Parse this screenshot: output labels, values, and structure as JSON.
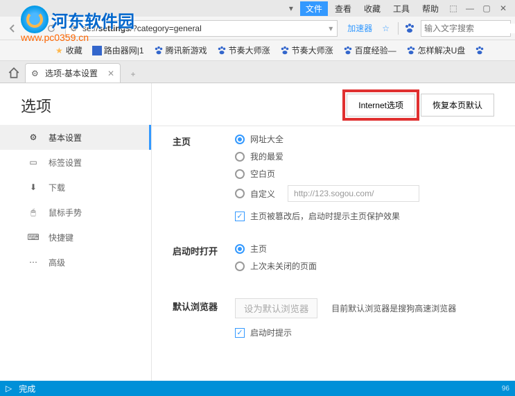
{
  "watermark": {
    "line1": "河东软件园",
    "line2": "www.pc0359.cn"
  },
  "menu": {
    "file": "文件",
    "view": "查看",
    "favorites": "收藏",
    "tools": "工具",
    "help": "帮助"
  },
  "url": {
    "prefix": "se://",
    "bold": "settings",
    "suffix": "/?category=general"
  },
  "accelerator": "加速器",
  "search": {
    "placeholder": "输入文字搜索"
  },
  "bookmarks": {
    "fav_label": "收藏",
    "items": [
      "路由器网|1",
      "腾讯新游戏",
      "节奏大师涨",
      "节奏大师涨",
      "百度经验—",
      "怎样解决U盘"
    ]
  },
  "tab": {
    "title": "选项-基本设置"
  },
  "page": {
    "title": "选项",
    "internet_btn": "Internet选项",
    "restore_btn": "恢复本页默认"
  },
  "sidebar": {
    "items": [
      {
        "label": "基本设置"
      },
      {
        "label": "标签设置"
      },
      {
        "label": "下载"
      },
      {
        "label": "鼠标手势"
      },
      {
        "label": "快捷键"
      },
      {
        "label": "高级"
      }
    ]
  },
  "sections": {
    "homepage": {
      "label": "主页",
      "opt1": "网址大全",
      "opt2": "我的最爱",
      "opt3": "空白页",
      "opt4": "自定义",
      "custom_url": "http://123.sogou.com/",
      "protect": "主页被篡改后，启动时提示主页保护效果"
    },
    "startup": {
      "label": "启动时打开",
      "opt1": "主页",
      "opt2": "上次未关闭的页面"
    },
    "default_browser": {
      "label": "默认浏览器",
      "btn": "设为默认浏览器",
      "status": "目前默认浏览器是搜狗高速浏览器",
      "check": "启动时提示"
    }
  },
  "status": {
    "text": "完成",
    "percent": "96"
  }
}
